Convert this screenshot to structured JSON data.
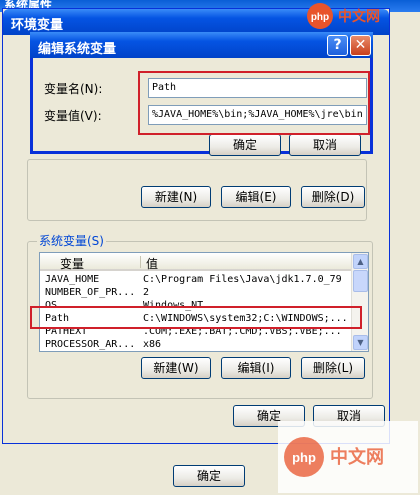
{
  "system_properties": {
    "title": "系统属性",
    "ok_button": "确定"
  },
  "env_window": {
    "title": "环境变量",
    "user_buttons": {
      "new": "新建(N)",
      "edit": "编辑(E)",
      "delete": "删除(D)"
    },
    "system_vars_group": "系统变量(S)",
    "columns": {
      "variable": "变量",
      "value": "值"
    },
    "system_vars": [
      {
        "name": "JAVA_HOME",
        "value": "C:\\Program Files\\Java\\jdk1.7.0_79"
      },
      {
        "name": "NUMBER_OF_PR...",
        "value": "2"
      },
      {
        "name": "OS",
        "value": "Windows_NT"
      },
      {
        "name": "Path",
        "value": "C:\\WINDOWS\\system32;C:\\WINDOWS;..."
      },
      {
        "name": "PATHEXT",
        "value": ".COM;.EXE;.BAT;.CMD;.VBS;.VBE;..."
      },
      {
        "name": "PROCESSOR_AR...",
        "value": "x86"
      }
    ],
    "system_buttons": {
      "new": "新建(W)",
      "edit": "编辑(I)",
      "delete": "删除(L)"
    },
    "ok_button": "确定",
    "cancel_button": "取消"
  },
  "edit_dialog": {
    "title": "编辑系统变量",
    "name_label": "变量名(N):",
    "value_label": "变量值(V):",
    "name_value": "Path",
    "value_value": "%JAVA_HOME%\\bin;%JAVA_HOME%\\jre\\bin",
    "ok_button": "确定",
    "cancel_button": "取消",
    "help_icon": "?",
    "close_icon": "✕"
  },
  "watermark": {
    "text": "php中文网"
  },
  "colors": {
    "titlebar": "#0554e3",
    "highlight_box": "#d0202a",
    "selection_accent": "#0046d5"
  }
}
